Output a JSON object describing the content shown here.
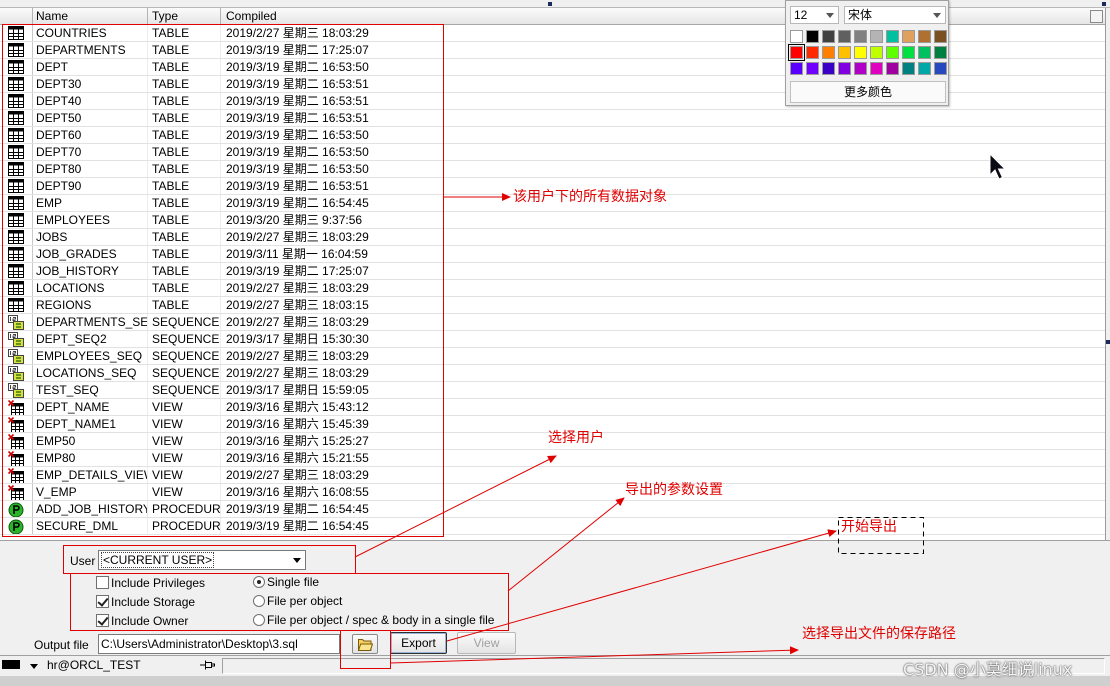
{
  "grid": {
    "columns": {
      "name": "Name",
      "type": "Type",
      "compiled": "Compiled"
    },
    "rows": [
      {
        "icon": "table-icon",
        "name": "COUNTRIES",
        "type": "TABLE",
        "compiled": "2019/2/27 星期三 18:03:29"
      },
      {
        "icon": "table-icon",
        "name": "DEPARTMENTS",
        "type": "TABLE",
        "compiled": "2019/3/19 星期二 17:25:07"
      },
      {
        "icon": "table-icon",
        "name": "DEPT",
        "type": "TABLE",
        "compiled": "2019/3/19 星期二 16:53:50"
      },
      {
        "icon": "table-icon",
        "name": "DEPT30",
        "type": "TABLE",
        "compiled": "2019/3/19 星期二 16:53:51"
      },
      {
        "icon": "table-icon",
        "name": "DEPT40",
        "type": "TABLE",
        "compiled": "2019/3/19 星期二 16:53:51"
      },
      {
        "icon": "table-icon",
        "name": "DEPT50",
        "type": "TABLE",
        "compiled": "2019/3/19 星期二 16:53:51"
      },
      {
        "icon": "table-icon",
        "name": "DEPT60",
        "type": "TABLE",
        "compiled": "2019/3/19 星期二 16:53:50"
      },
      {
        "icon": "table-icon",
        "name": "DEPT70",
        "type": "TABLE",
        "compiled": "2019/3/19 星期二 16:53:50"
      },
      {
        "icon": "table-icon",
        "name": "DEPT80",
        "type": "TABLE",
        "compiled": "2019/3/19 星期二 16:53:50"
      },
      {
        "icon": "table-icon",
        "name": "DEPT90",
        "type": "TABLE",
        "compiled": "2019/3/19 星期二 16:53:51"
      },
      {
        "icon": "table-icon",
        "name": "EMP",
        "type": "TABLE",
        "compiled": "2019/3/19 星期二 16:54:45"
      },
      {
        "icon": "table-icon",
        "name": "EMPLOYEES",
        "type": "TABLE",
        "compiled": "2019/3/20 星期三 9:37:56"
      },
      {
        "icon": "table-icon",
        "name": "JOBS",
        "type": "TABLE",
        "compiled": "2019/2/27 星期三 18:03:29"
      },
      {
        "icon": "table-icon",
        "name": "JOB_GRADES",
        "type": "TABLE",
        "compiled": "2019/3/11 星期一 16:04:59"
      },
      {
        "icon": "table-icon",
        "name": "JOB_HISTORY",
        "type": "TABLE",
        "compiled": "2019/3/19 星期二 17:25:07"
      },
      {
        "icon": "table-icon",
        "name": "LOCATIONS",
        "type": "TABLE",
        "compiled": "2019/2/27 星期三 18:03:29"
      },
      {
        "icon": "table-icon",
        "name": "REGIONS",
        "type": "TABLE",
        "compiled": "2019/2/27 星期三 18:03:15"
      },
      {
        "icon": "sequence-icon",
        "name": "DEPARTMENTS_SEQ",
        "type": "SEQUENCE",
        "compiled": "2019/2/27 星期三 18:03:29"
      },
      {
        "icon": "sequence-icon",
        "name": "DEPT_SEQ2",
        "type": "SEQUENCE",
        "compiled": "2019/3/17 星期日 15:30:30"
      },
      {
        "icon": "sequence-icon",
        "name": "EMPLOYEES_SEQ",
        "type": "SEQUENCE",
        "compiled": "2019/2/27 星期三 18:03:29"
      },
      {
        "icon": "sequence-icon",
        "name": "LOCATIONS_SEQ",
        "type": "SEQUENCE",
        "compiled": "2019/2/27 星期三 18:03:29"
      },
      {
        "icon": "sequence-icon",
        "name": "TEST_SEQ",
        "type": "SEQUENCE",
        "compiled": "2019/3/17 星期日 15:59:05"
      },
      {
        "icon": "view-icon",
        "name": "DEPT_NAME",
        "type": "VIEW",
        "compiled": "2019/3/16 星期六 15:43:12"
      },
      {
        "icon": "view-icon",
        "name": "DEPT_NAME1",
        "type": "VIEW",
        "compiled": "2019/3/16 星期六 15:45:39"
      },
      {
        "icon": "view-icon",
        "name": "EMP50",
        "type": "VIEW",
        "compiled": "2019/3/16 星期六 15:25:27"
      },
      {
        "icon": "view-icon",
        "name": "EMP80",
        "type": "VIEW",
        "compiled": "2019/3/16 星期六 15:21:55"
      },
      {
        "icon": "view-icon",
        "name": "EMP_DETAILS_VIEW",
        "type": "VIEW",
        "compiled": "2019/2/27 星期三 18:03:29"
      },
      {
        "icon": "view-icon",
        "name": "V_EMP",
        "type": "VIEW",
        "compiled": "2019/3/16 星期六 16:08:55"
      },
      {
        "icon": "procedure-icon",
        "name": "ADD_JOB_HISTORY",
        "type": "PROCEDURE",
        "compiled": "2019/3/19 星期二 16:54:45"
      },
      {
        "icon": "procedure-icon",
        "name": "SECURE_DML",
        "type": "PROCEDURE",
        "compiled": "2019/3/19 星期二 16:54:45"
      }
    ]
  },
  "font_popup": {
    "font_size": "12",
    "font_name": "宋体",
    "palette": [
      [
        "#ffffff",
        "#000000",
        "#404040",
        "#606060",
        "#808080",
        "#b4b4b4",
        "#00c0a0",
        "#e0a060",
        "#b07030",
        "#7a5020"
      ],
      [
        "#ff0000",
        "#ff2a00",
        "#ff8000",
        "#ffc000",
        "#ffff00",
        "#c0ff00",
        "#60ff00",
        "#00e040",
        "#00c060",
        "#008040"
      ],
      [
        "#5a00ff",
        "#7000ff",
        "#3a00c8",
        "#8000e0",
        "#b000c8",
        "#e000c0",
        "#a000a0",
        "#008080",
        "#00a8a8",
        "#2848c0"
      ]
    ],
    "selected_color": "#ff0000",
    "more_colors_label": "更多颜色"
  },
  "export_panel": {
    "user_label": "User",
    "user_value": "<CURRENT USER>",
    "options": [
      {
        "label": "Include Privileges",
        "checked": false
      },
      {
        "label": "Include Storage",
        "checked": true
      },
      {
        "label": "Include Owner",
        "checked": true
      }
    ],
    "file_modes": [
      {
        "label": "Single file",
        "selected": true
      },
      {
        "label": "File per object",
        "selected": false
      },
      {
        "label": "File per object / spec & body in a single file",
        "selected": false
      }
    ],
    "output_file_label": "Output file",
    "output_file_value": "C:\\Users\\Administrator\\Desktop\\3.sql",
    "folder_button_icon": "folder-open-icon",
    "export_label": "Export",
    "view_label": "View"
  },
  "status_bar": {
    "color_swatch": "#000000",
    "connection": "hr@ORCL_TEST",
    "pin_icon": "pin-icon"
  },
  "annotations": {
    "color": "#e00000",
    "all_objects": "该用户下的所有数据对象",
    "select_user": "选择用户",
    "export_params": "导出的参数设置",
    "start_export": "开始导出",
    "select_path": "选择导出文件的保存路径"
  },
  "watermark": "CSDN @小莫细说linux"
}
